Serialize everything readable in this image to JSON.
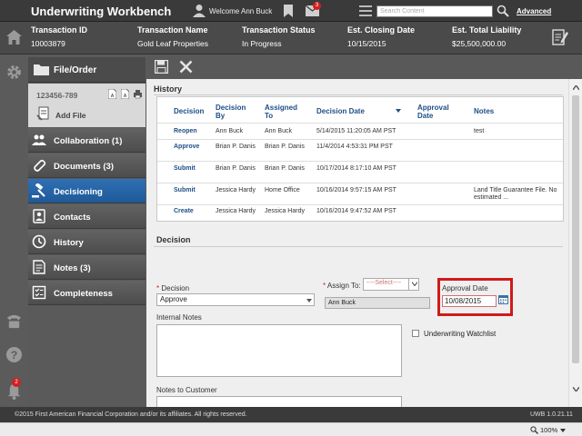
{
  "header": {
    "app_title": "Underwriting Workbench",
    "welcome": "Welcome Ann Buck",
    "mail_count": "3",
    "search_placeholder": "Search Content",
    "advanced_label": "Advanced"
  },
  "summary": {
    "columns": [
      {
        "label": "Transaction ID",
        "value": "10003879"
      },
      {
        "label": "Transaction Name",
        "value": "Gold Leaf Properties"
      },
      {
        "label": "Transaction Status",
        "value": "In Progress"
      },
      {
        "label": "Est. Closing Date",
        "value": "10/15/2015"
      },
      {
        "label": "Est. Total Liability",
        "value": "$25,500,000.00"
      }
    ]
  },
  "rail": {
    "notification_count": "2"
  },
  "sidenav": {
    "file_order_label": "File/Order",
    "file_number": "123456-789",
    "add_file_label": "Add File",
    "items": [
      {
        "label": "Collaboration (1)",
        "icon": "collaboration-icon"
      },
      {
        "label": "Documents (3)",
        "icon": "paperclip-icon"
      },
      {
        "label": "Decisioning",
        "icon": "gavel-icon",
        "active": true
      },
      {
        "label": "Contacts",
        "icon": "contacts-icon"
      },
      {
        "label": "History",
        "icon": "clock-icon"
      },
      {
        "label": "Notes (3)",
        "icon": "notes-icon"
      },
      {
        "label": "Completeness",
        "icon": "checklist-icon"
      }
    ]
  },
  "history": {
    "title": "History",
    "headers": {
      "decision": "Decision",
      "decision_by": "Decision By",
      "assigned_to": "Assigned To",
      "decision_date": "Decision Date",
      "approval_date": "Approval Date",
      "notes": "Notes"
    },
    "rows": [
      {
        "decision": "Reopen",
        "by": "Ann Buck",
        "assigned": "Ann Buck",
        "date": "5/14/2015 11:20:05 AM PST",
        "approval": "",
        "notes": "test"
      },
      {
        "decision": "Approve",
        "by": "Brian P. Danis",
        "assigned": "Brian P. Danis",
        "date": "11/4/2014 4:53:31 PM PST",
        "approval": "",
        "notes": ""
      },
      {
        "decision": "Submit",
        "by": "Brian P. Danis",
        "assigned": "Brian P. Danis",
        "date": "10/17/2014 8:17:10 AM PST",
        "approval": "",
        "notes": ""
      },
      {
        "decision": "Submit",
        "by": "Jessica Hardy",
        "assigned": "Home Office",
        "date": "10/16/2014 9:57:15 AM PST",
        "approval": "",
        "notes": "Land Title Guarantee File. No estimated ..."
      },
      {
        "decision": "Create",
        "by": "Jessica Hardy",
        "assigned": "Jessica Hardy",
        "date": "10/16/2014 9:47:52 AM PST",
        "approval": "",
        "notes": ""
      }
    ]
  },
  "decision": {
    "title": "Decision",
    "decision_label": "Decision",
    "decision_value": "Approve",
    "assign_label": "Assign To:",
    "assign_select": "----Select----",
    "assign_value": "Ann Buck",
    "approval_label": "Approval Date",
    "approval_value": "10/08/2015",
    "internal_notes_label": "Internal Notes",
    "watchlist_label": "Underwriting Watchlist",
    "notes_customer_label": "Notes to Customer"
  },
  "footer": {
    "copyright": "©2015 First American Financial Corporation and/or its affiliates. All rights reserved.",
    "version": "UWB 1.0.21.11",
    "zoom": "100%"
  },
  "colors": {
    "active_nav": "#2f6fb3",
    "link_blue": "#1e4e86",
    "badge_red": "#d42020",
    "highlight_red": "#d01a1a"
  }
}
